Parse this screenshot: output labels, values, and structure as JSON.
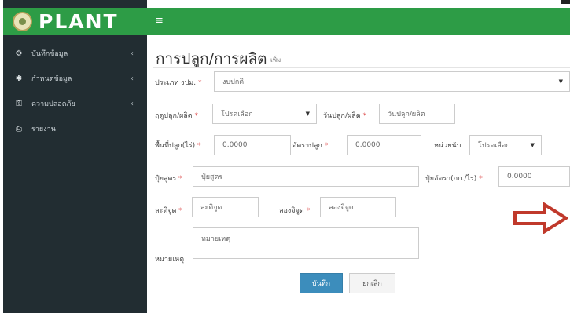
{
  "app": {
    "brand": "PLANT",
    "menu_icon": "hamburger-icon"
  },
  "sidebar": {
    "items": [
      {
        "label": "บันทึกข้อมูล",
        "icon": "gear-icon"
      },
      {
        "label": "กำหนดข้อมูล",
        "icon": "cog-icon"
      },
      {
        "label": "ความปลอดภัย",
        "icon": "key-icon"
      },
      {
        "label": "รายงาน",
        "icon": "printer-icon"
      }
    ]
  },
  "page": {
    "title": "การปลูก/การผลิต",
    "subtitle": "เพิ่ม"
  },
  "form": {
    "plant_type_label": "ประเภท งปม.",
    "plant_type_value": "งบปกติ",
    "plant_season_label": "ฤดูปลูก/ผลิต",
    "plant_season_value": "โปรดเลือก",
    "plant_date_label": "วันปลูก/ผลิต",
    "plant_date_placeholder": "วันปลูก/ผลิต",
    "area_label": "พื้นที่ปลูก(ไร่)",
    "area_value": "0.0000",
    "rate_label": "อัตราปลูก",
    "rate_value": "0.0000",
    "unit_label": "หน่วยนับ",
    "unit_value": "โปรดเลือก",
    "fertilizer_label": "ปุ๋ยสูตร",
    "fertilizer_placeholder": "ปุ๋ยสูตร",
    "fert_rate_label": "ปุ๋ยอัตรา(กก./ไร่)",
    "fert_rate_value": "0.0000",
    "lat_label": "ละติจูด",
    "lat_placeholder": "ละติจูด",
    "lon_label": "ลองจิจูด",
    "lon_placeholder": "ลองจิจูด",
    "note_label": "หมายเหตุ",
    "note_placeholder": "หมายเหตุ",
    "save_label": "บันทึก",
    "cancel_label": "ยกเลิก",
    "required_mark": "*"
  },
  "colors": {
    "header": "#2d9c46",
    "sidebar": "#222d32",
    "save": "#3c8dbc",
    "arrow": "#c0392b"
  }
}
